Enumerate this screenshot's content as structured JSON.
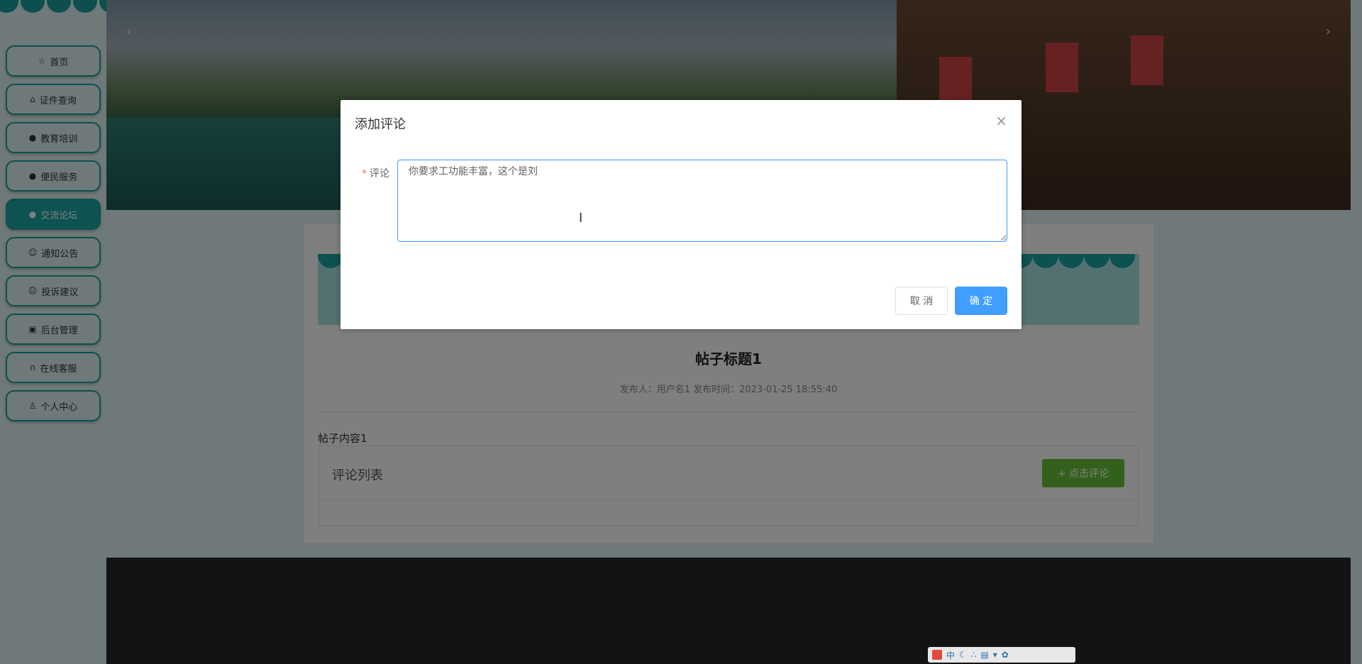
{
  "sidebar": {
    "items": [
      {
        "label": "首页",
        "icon": "star-icon"
      },
      {
        "label": "证件查询",
        "icon": "bag-icon"
      },
      {
        "label": "教育培训",
        "icon": "info-icon"
      },
      {
        "label": "便民服务",
        "icon": "help-icon"
      },
      {
        "label": "交流论坛",
        "icon": "info-icon",
        "active": true
      },
      {
        "label": "通知公告",
        "icon": "smile-icon"
      },
      {
        "label": "投诉建议",
        "icon": "sad-icon"
      },
      {
        "label": "后台管理",
        "icon": "suitcase-icon"
      },
      {
        "label": "在线客服",
        "icon": "headset-icon"
      },
      {
        "label": "个人中心",
        "icon": "user-icon"
      }
    ]
  },
  "banner": {
    "prev": "‹",
    "next": "›"
  },
  "post": {
    "title": "帖子标题1",
    "meta": "发布人：用户名1  发布时间：2023-01-25 18:55:40",
    "content": "帖子内容1"
  },
  "comments": {
    "title": "评论列表",
    "add_button": "+ 点击评论"
  },
  "dialog": {
    "title": "添加评论",
    "close": "×",
    "field_label": "评论",
    "required_mark": "*",
    "comment_value": "你要求工功能丰富，这个是刘",
    "cancel": "取 消",
    "confirm": "确 定"
  },
  "ime": {
    "label": "中"
  },
  "colors": {
    "accent": "#19a6a4",
    "primary": "#409eff",
    "success": "#67c23a",
    "footer": "#262626"
  }
}
